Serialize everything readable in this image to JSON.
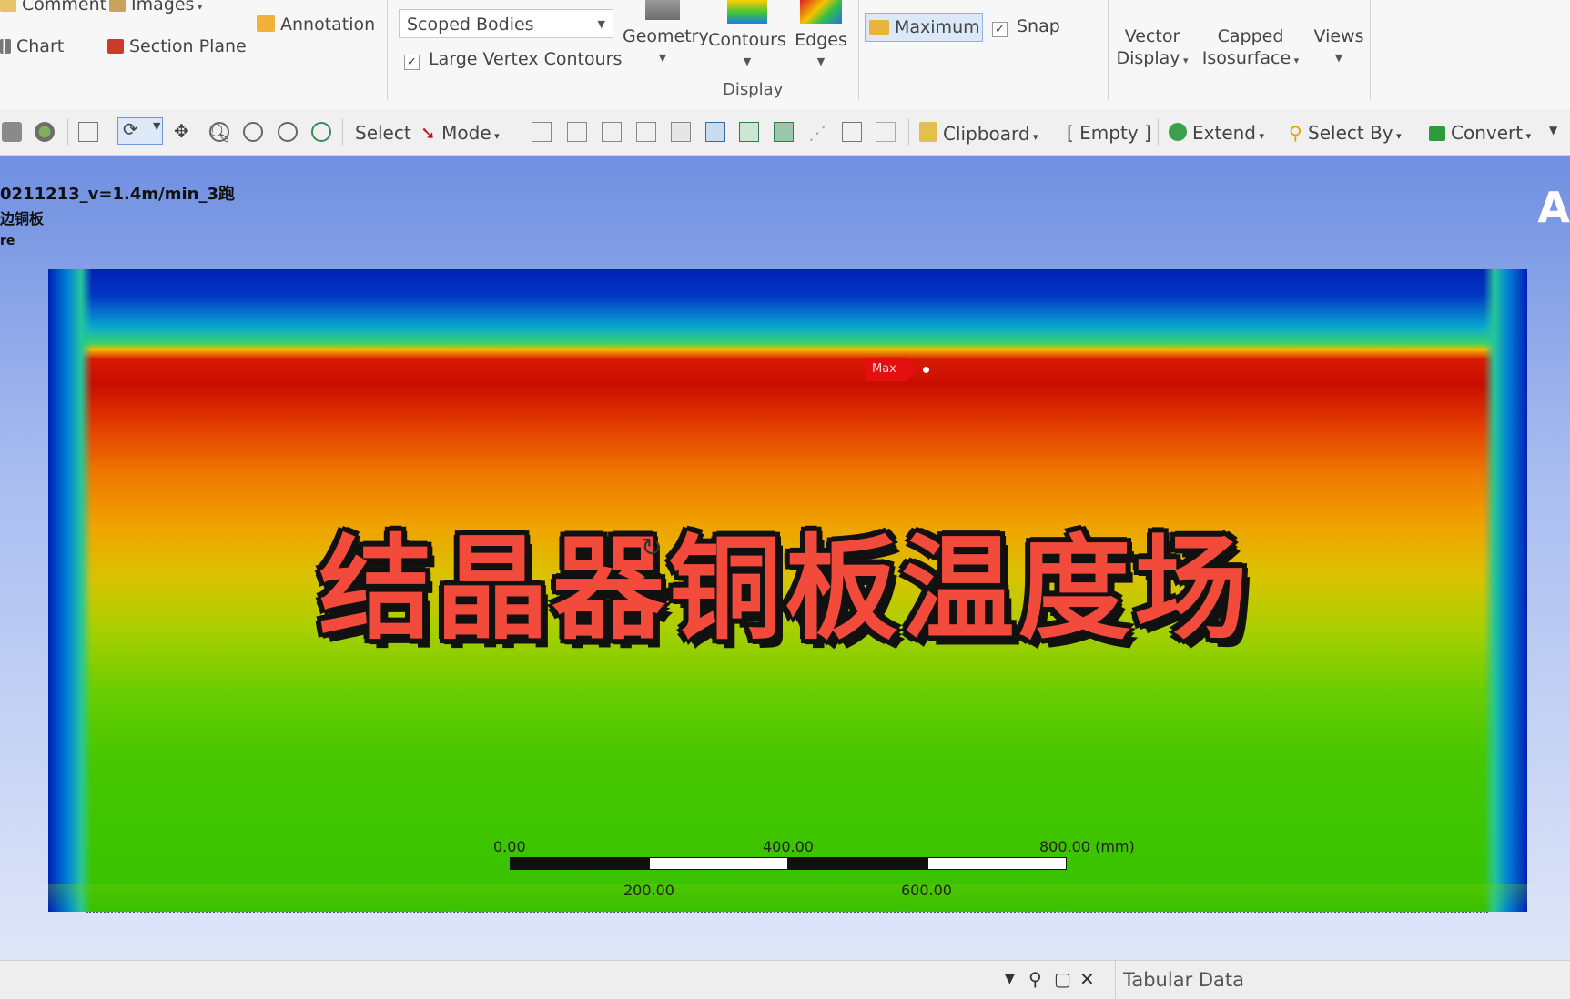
{
  "ribbon": {
    "comment": "Comment",
    "images": "Images",
    "chart": "Chart",
    "section_plane": "Section Plane",
    "annotation": "Annotation",
    "scope_select": "Scoped Bodies",
    "large_vertex_contours": "Large Vertex Contours",
    "geometry": "Geometry",
    "contours": "Contours",
    "edges": "Edges",
    "display_group": "Display",
    "maximum": "Maximum",
    "snap": "Snap",
    "vector_display_1": "Vector",
    "vector_display_2": "Display",
    "capped_isosurface_1": "Capped",
    "capped_isosurface_2": "Isosurface",
    "views": "Views"
  },
  "toolbar": {
    "select": "Select",
    "mode": "Mode",
    "clipboard": "Clipboard",
    "empty": "[ Empty ]",
    "extend": "Extend",
    "select_by": "Select By",
    "convert": "Convert"
  },
  "viewport": {
    "info_line1": "0211213_v=1.4m/min_3跑",
    "info_line2": "边铜板",
    "info_line3": "re",
    "corner_mark": "A",
    "max_tag": "Max",
    "overlay_title": "结晶器铜板温度场",
    "scale": {
      "top_labels": [
        "0.00",
        "400.00",
        "800.00 (mm)"
      ],
      "bottom_labels": [
        "200.00",
        "600.00"
      ]
    }
  },
  "bottom": {
    "tabular_data": "Tabular Data"
  },
  "colors": {
    "contour_max": "#c80e00",
    "contour_min": "#0022b5",
    "overlay_text": "#f24b3c",
    "maximum_button": "#dbe8f7"
  }
}
